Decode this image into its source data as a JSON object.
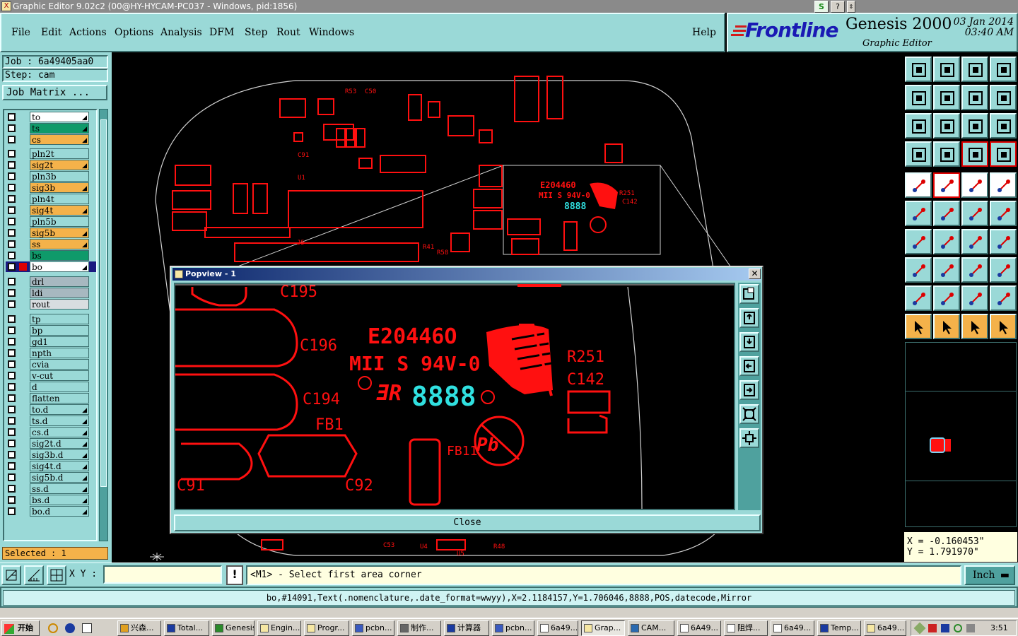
{
  "window": {
    "title": "Graphic Editor 9.02c2 (00@HY-HYCAM-PC037 - Windows, pid:1856)"
  },
  "menu": {
    "items": [
      "File",
      "Edit",
      "Actions",
      "Options",
      "Analysis",
      "DFM",
      "Step",
      "Rout",
      "Windows"
    ],
    "help": "Help"
  },
  "branding": {
    "logo": "Frontline",
    "product": "Genesis 2000",
    "subtitle": "Graphic Editor",
    "date": "03 Jan 2014",
    "time": "03:40 AM"
  },
  "job": {
    "job_label": "Job : 6a49405aa0",
    "step_label": "Step: cam",
    "matrix_button": "Job Matrix ..."
  },
  "layers": [
    {
      "name": "to",
      "color": "#ffffff",
      "arrow": true
    },
    {
      "name": "ts",
      "color": "#0f9a6a",
      "arrow": true
    },
    {
      "name": "cs",
      "color": "#f4b24a",
      "arrow": true
    },
    {
      "name": "pln2t",
      "color": "#9ad9d7",
      "arrow": false
    },
    {
      "name": "sig2t",
      "color": "#f4b24a",
      "arrow": true
    },
    {
      "name": "pln3b",
      "color": "#9ad9d7",
      "arrow": false
    },
    {
      "name": "sig3b",
      "color": "#f4b24a",
      "arrow": true
    },
    {
      "name": "pln4t",
      "color": "#9ad9d7",
      "arrow": false
    },
    {
      "name": "sig4t",
      "color": "#f4b24a",
      "arrow": true
    },
    {
      "name": "pln5b",
      "color": "#9ad9d7",
      "arrow": false
    },
    {
      "name": "sig5b",
      "color": "#f4b24a",
      "arrow": true
    },
    {
      "name": "ss",
      "color": "#f4b24a",
      "arrow": true
    },
    {
      "name": "bs",
      "color": "#0f9a6a",
      "arrow": false
    },
    {
      "name": "bo",
      "color": "#ffffff",
      "arrow": true
    },
    {
      "name": "drl",
      "color": "#a7b8c0",
      "arrow": false
    },
    {
      "name": "ldi",
      "color": "#a7b8c0",
      "arrow": false
    },
    {
      "name": "rout",
      "color": "#d8dde0",
      "arrow": false
    },
    {
      "name": "tp",
      "color": "#9ad9d7",
      "arrow": false
    },
    {
      "name": "bp",
      "color": "#9ad9d7",
      "arrow": false
    },
    {
      "name": "gd1",
      "color": "#9ad9d7",
      "arrow": false
    },
    {
      "name": "npth",
      "color": "#9ad9d7",
      "arrow": false
    },
    {
      "name": "cvia",
      "color": "#9ad9d7",
      "arrow": false
    },
    {
      "name": "v-cut",
      "color": "#9ad9d7",
      "arrow": false
    },
    {
      "name": "d",
      "color": "#9ad9d7",
      "arrow": false
    },
    {
      "name": "flatten",
      "color": "#9ad9d7",
      "arrow": false
    },
    {
      "name": "to.d",
      "color": "#9ad9d7",
      "arrow": true
    },
    {
      "name": "ts.d",
      "color": "#9ad9d7",
      "arrow": true
    },
    {
      "name": "cs.d",
      "color": "#9ad9d7",
      "arrow": true
    },
    {
      "name": "sig2t.d",
      "color": "#9ad9d7",
      "arrow": true
    },
    {
      "name": "sig3b.d",
      "color": "#9ad9d7",
      "arrow": true
    },
    {
      "name": "sig4t.d",
      "color": "#9ad9d7",
      "arrow": true
    },
    {
      "name": "sig5b.d",
      "color": "#9ad9d7",
      "arrow": true
    },
    {
      "name": "ss.d",
      "color": "#9ad9d7",
      "arrow": true
    },
    {
      "name": "bs.d",
      "color": "#9ad9d7",
      "arrow": true
    },
    {
      "name": "bo.d",
      "color": "#9ad9d7",
      "arrow": true
    }
  ],
  "selected_label": "Selected : 1",
  "coords": {
    "x": "X = -0.160453\"",
    "y": "Y = 1.791970\""
  },
  "bottom": {
    "xy_label": "X Y :",
    "xy_value": "",
    "prompt": "<M1> - Select first area corner",
    "units": "Inch"
  },
  "status_text": "bo,#14091,Text(.nomenclature,.date_format=wwyy),X=2.1184157,Y=1.706046,8888,POS,datecode,Mirror",
  "popview": {
    "title": "Popview - 1",
    "close_label": "Close",
    "board_text": {
      "code": "E20446O",
      "rating": "MII S 94V-0",
      "date": "8888",
      "labels": [
        "C195",
        "C196",
        "C194",
        "C92",
        "C91",
        "FB1",
        "FB11",
        "R251",
        "C142"
      ]
    }
  },
  "canvas_labels": [
    "E204460",
    "MII S 94V-0",
    "R251",
    "C142",
    "C195",
    "C196",
    "C194",
    "FB1",
    "C92",
    "C91",
    "U1",
    "J5",
    "R53",
    "C50",
    "C53",
    "U4",
    "U5",
    "R48",
    "R41",
    "R58",
    "R50"
  ],
  "taskbar": {
    "start": "开始",
    "items": [
      "兴森...",
      "Total...",
      "Genesis",
      "Engin...",
      "Progr...",
      "pcbn...",
      "制作...",
      "计算器",
      "pcbn...",
      "6a49...",
      "Grap...",
      "CAM...",
      "6A49...",
      "阻焊...",
      "6a49...",
      "Temp...",
      "6a49..."
    ],
    "active_index": 10,
    "clock": "3:51"
  },
  "colors": {
    "panel": "#9ad9d7",
    "pcb_red": "#ff1010",
    "accent_orange": "#f4b24a",
    "cyan_text": "#30e0e0"
  }
}
